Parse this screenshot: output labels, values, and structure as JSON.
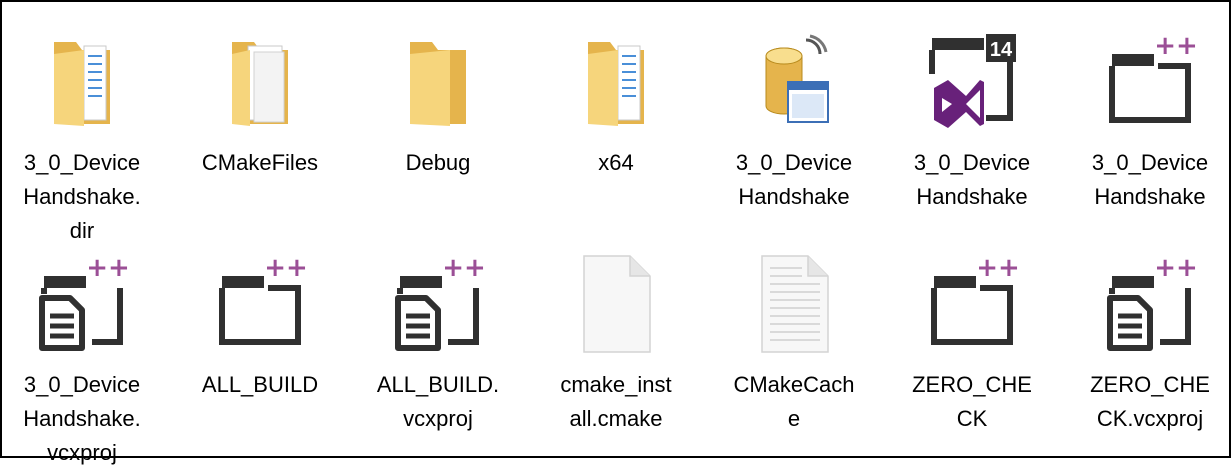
{
  "items": [
    {
      "icon": "folder-docs-icon",
      "label": "3_0_Device\nHandshake.\ndir"
    },
    {
      "icon": "folder-files-icon",
      "label": "CMakeFiles"
    },
    {
      "icon": "folder-icon",
      "label": "Debug"
    },
    {
      "icon": "folder-docs-icon",
      "label": "x64"
    },
    {
      "icon": "database-window-icon",
      "label": "3_0_Device\nHandshake"
    },
    {
      "icon": "visual-studio-14-icon",
      "label": "3_0_Device\nHandshake"
    },
    {
      "icon": "vcxproj-window-icon",
      "label": "3_0_Device\nHandshake"
    },
    {
      "icon": "vcxproj-doc-icon",
      "label": "3_0_Device\nHandshake.\nvcxproj"
    },
    {
      "icon": "vcxproj-window-icon",
      "label": "ALL_BUILD"
    },
    {
      "icon": "vcxproj-doc-icon",
      "label": "ALL_BUILD.\nvcxproj"
    },
    {
      "icon": "blank-file-icon",
      "label": "cmake_inst\nall.cmake"
    },
    {
      "icon": "text-file-icon",
      "label": "CMakeCach\ne"
    },
    {
      "icon": "vcxproj-window-icon",
      "label": "ZERO_CHE\nCK"
    },
    {
      "icon": "vcxproj-doc-icon",
      "label": "ZERO_CHE\nCK.vcxproj"
    }
  ],
  "colors": {
    "folder": "#f4cd6b",
    "folder_dark": "#e5b44c",
    "vs_purple": "#68217a",
    "plus_purple": "#9b4f96",
    "icon_dark": "#303030"
  }
}
